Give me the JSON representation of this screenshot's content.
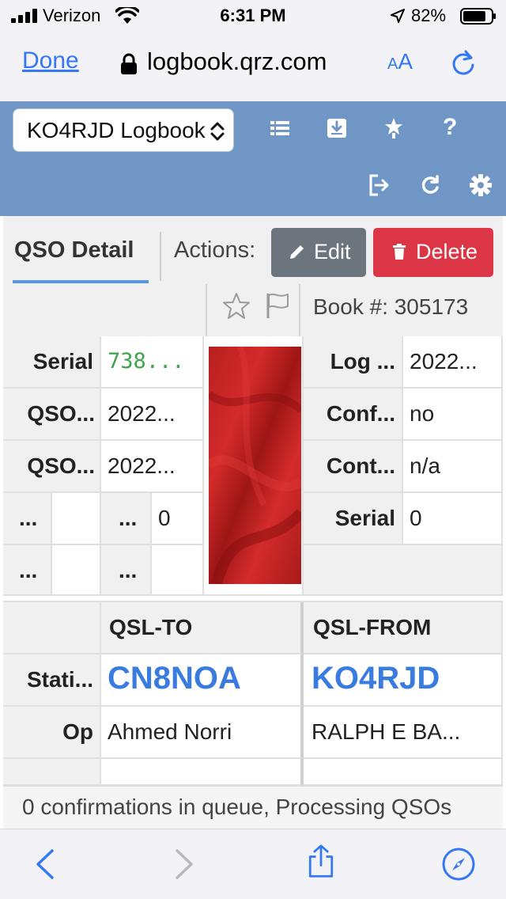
{
  "status_bar": {
    "carrier": "Verizon",
    "time": "6:31 PM",
    "battery_percent": "82%",
    "battery_level": 0.82
  },
  "browser": {
    "done_label": "Done",
    "url": "logbook.qrz.com",
    "text_size_label_small": "A",
    "text_size_label_large": "A"
  },
  "header": {
    "logbook_selected": "KO4RJD Logbook",
    "icons": [
      "list-icon",
      "download-icon",
      "award-star-icon",
      "help-icon",
      "logout-icon",
      "refresh-icon",
      "settings-gear-icon"
    ],
    "help_label": "?"
  },
  "tabs": {
    "qso_detail": "QSO Detail",
    "actions_label": "Actions:",
    "edit_label": "Edit",
    "delete_label": "Delete"
  },
  "book": {
    "label": "Book #: 305173"
  },
  "detail_left": [
    {
      "label": "Serial",
      "value": "738..."
    },
    {
      "label": "QSO...",
      "value": "2022..."
    },
    {
      "label": "QSO...",
      "value": "2022..."
    }
  ],
  "detail_left_extra": [
    {
      "a": "...",
      "b": "...",
      "c": "0"
    },
    {
      "a": "...",
      "b": "...",
      "c": ""
    }
  ],
  "detail_right": [
    {
      "label": "Log ...",
      "value": "2022..."
    },
    {
      "label": "Conf...",
      "value": "no"
    },
    {
      "label": "Cont...",
      "value": "n/a"
    },
    {
      "label": "Serial",
      "value": "0"
    }
  ],
  "qsl": {
    "to_header": "QSL-TO",
    "from_header": "QSL-FROM",
    "station_label": "Stati...",
    "op_label": "Op",
    "to_station": "CN8NOA",
    "from_station": "KO4RJD",
    "to_op": "Ahmed Norri",
    "from_op": "RALPH E BA..."
  },
  "queue": {
    "text": "0 confirmations in queue, Processing QSOs"
  },
  "colors": {
    "header_bg": "#6f96c4",
    "link_blue": "#3a7be0",
    "edit_btn": "#6c757d",
    "delete_btn": "#dc3545",
    "serial_green": "#3fa34d"
  }
}
